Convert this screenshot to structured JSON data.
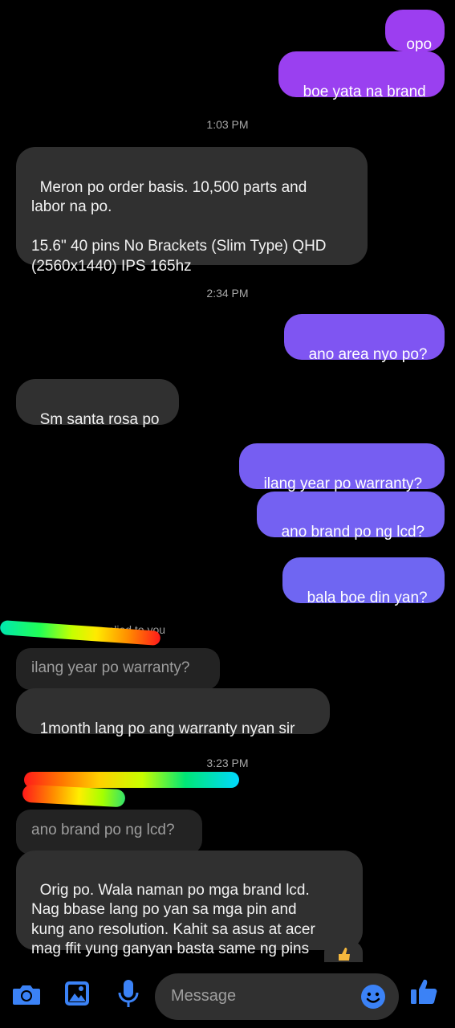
{
  "messages": {
    "s_opo": "opo",
    "s_boe": "boe yata na brand",
    "ts1": "1:03 PM",
    "r_meron": "Meron po order basis. 10,500 parts and\nlabor na po.\n\n15.6\" 40 pins No Brackets (Slim Type) QHD\n(2560x1440) IPS 165hz",
    "ts2": "2:34 PM",
    "s_area": "ano area nyo po?",
    "r_sm": "Sm santa rosa po",
    "s_ilang": "ilang year po warranty?",
    "s_ano_brand": "ano brand po ng lcd?",
    "s_bala": "bala boe din yan?",
    "reply_label": "replied to you",
    "quote1": "ilang year po warranty?",
    "r_1month": "1month lang po ang warranty nyan sir",
    "ts3": "3:23 PM",
    "quote2": "ano brand po ng lcd?",
    "r_orig": "Orig po. Wala naman po mga brand lcd.\nNag bbase lang po yan sa mga pin and\nkung ano resolution. Kahit sa asus at acer\nmag ffit yung ganyan basta same ng pins"
  },
  "composer": {
    "placeholder": "Message",
    "icons": [
      "camera-icon",
      "gallery-icon",
      "microphone-icon",
      "emoji-icon",
      "thumbs-up-icon"
    ]
  },
  "colors": {
    "sent_top": "#9d3ef0",
    "sent_bottom": "#6f63f2",
    "received": "#303030",
    "accent": "#3b82f6"
  }
}
